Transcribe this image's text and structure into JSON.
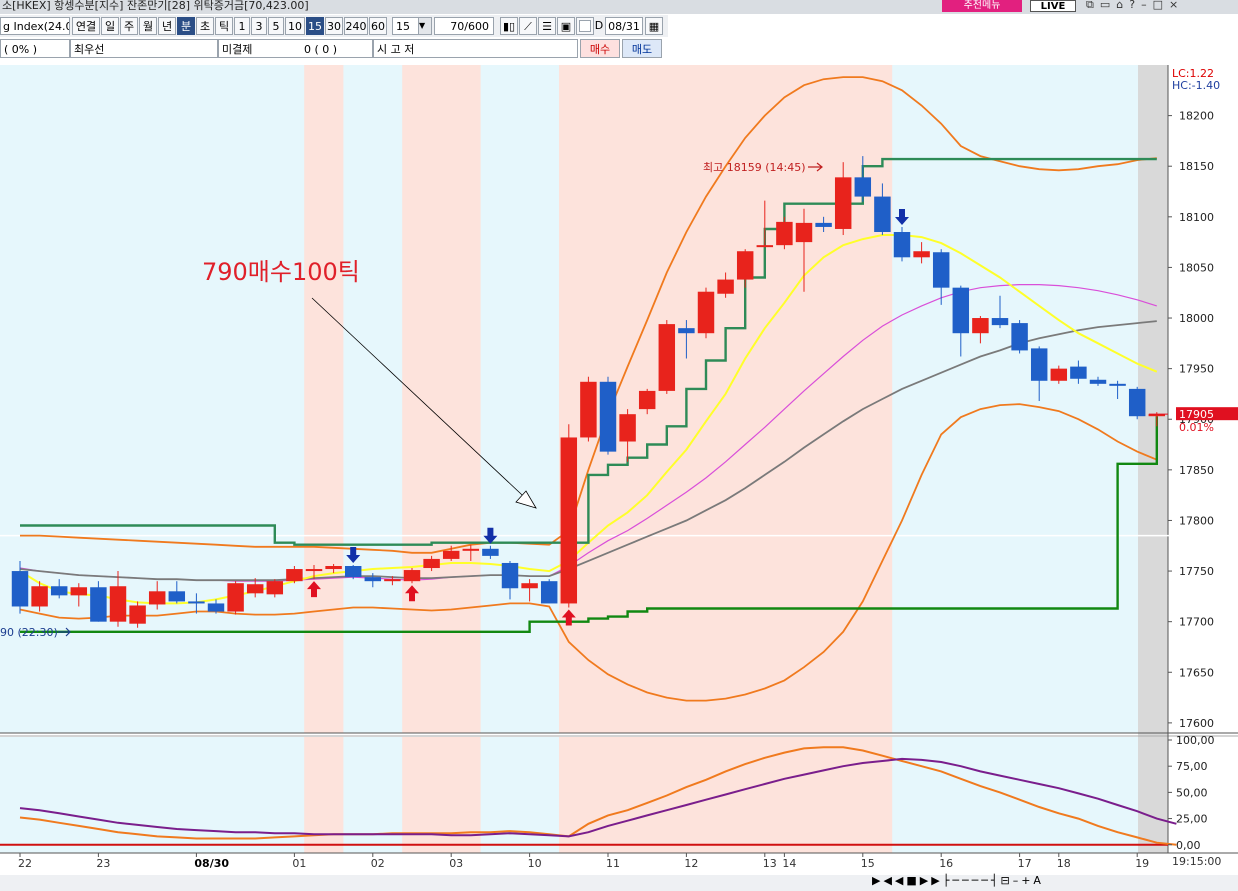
{
  "window": {
    "title": "소[HKEX] 항셍수분[지수] 잔존만기[28] 위탁증거금[70,423.00]",
    "promo_label": "추천메뉴",
    "live_label": "LIVE"
  },
  "toolbar": {
    "symbol": "g Index(24.0",
    "buttons": [
      "연결",
      "일",
      "주",
      "월",
      "년",
      "분",
      "초",
      "틱",
      "1",
      "3",
      "5",
      "10",
      "15",
      "30",
      "240",
      "60"
    ],
    "selected": [
      "분",
      "15"
    ],
    "interval_value": "15",
    "count_value": "70/600",
    "d_label": "D",
    "date_value": "08/31"
  },
  "inforow": {
    "change": "(      0%  )",
    "best_label": "최우선",
    "unsettled_label": "미결제",
    "unsettled_value": "0 (       0     )",
    "ohl_label": "시          고          저",
    "buy_label": "매수",
    "sell_label": "매도"
  },
  "colors": {
    "up": "#e8231c",
    "down": "#1f5fc8",
    "shade_pink": "#fde3dc",
    "bg_cyan": "#e6f7fc",
    "band": "#f07a1e",
    "ma_yellow": "#ffff2a",
    "ma_magenta": "#d94fd9",
    "ma_gray": "#7a7a7a",
    "trail_upper": "#2e8b57",
    "trail_lower": "#118811",
    "stoch1": "#7a1e8c",
    "stoch2": "#f07a1e"
  },
  "chart_data": {
    "type": "candlestick",
    "legend": [
      "LC:1.22",
      "HC:-1.40"
    ],
    "y_ticks": [
      18200,
      18150,
      18100,
      18050,
      18000,
      17950,
      17900,
      17850,
      17800,
      17750,
      17700,
      17650,
      17600
    ],
    "ylim": [
      17590,
      18250
    ],
    "price_label": "17905",
    "price_change": "0.01%",
    "high_annotation": "최고 18159 (14:45)",
    "low_annotation": "90 (22:30)",
    "annotation": "790매수100틱",
    "x_labels": [
      "22",
      "23",
      "08/30",
      "01",
      "02",
      "03",
      "10",
      "11",
      "12",
      "13",
      "14",
      "15",
      "16",
      "17",
      "18",
      "19"
    ],
    "time_label": "19:15:00",
    "white_line": 17785,
    "candles": [
      {
        "o": 17750,
        "h": 17760,
        "l": 17708,
        "c": 17715
      },
      {
        "o": 17715,
        "h": 17740,
        "l": 17710,
        "c": 17735
      },
      {
        "o": 17735,
        "h": 17742,
        "l": 17723,
        "c": 17726
      },
      {
        "o": 17726,
        "h": 17738,
        "l": 17715,
        "c": 17734
      },
      {
        "o": 17734,
        "h": 17740,
        "l": 17700,
        "c": 17700
      },
      {
        "o": 17700,
        "h": 17750,
        "l": 17695,
        "c": 17735
      },
      {
        "o": 17698,
        "h": 17720,
        "l": 17694,
        "c": 17716
      },
      {
        "o": 17717,
        "h": 17740,
        "l": 17712,
        "c": 17730
      },
      {
        "o": 17730,
        "h": 17740,
        "l": 17718,
        "c": 17720
      },
      {
        "o": 17720,
        "h": 17728,
        "l": 17708,
        "c": 17718
      },
      {
        "o": 17718,
        "h": 17722,
        "l": 17708,
        "c": 17710
      },
      {
        "o": 17710,
        "h": 17740,
        "l": 17707,
        "c": 17738
      },
      {
        "o": 17728,
        "h": 17743,
        "l": 17724,
        "c": 17737
      },
      {
        "o": 17727,
        "h": 17742,
        "l": 17724,
        "c": 17740
      },
      {
        "o": 17740,
        "h": 17755,
        "l": 17738,
        "c": 17752
      },
      {
        "o": 17750,
        "h": 17756,
        "l": 17742,
        "c": 17752
      },
      {
        "o": 17752,
        "h": 17757,
        "l": 17748,
        "c": 17755
      },
      {
        "o": 17755,
        "h": 17756,
        "l": 17742,
        "c": 17744
      },
      {
        "o": 17744,
        "h": 17748,
        "l": 17734,
        "c": 17740
      },
      {
        "o": 17740,
        "h": 17745,
        "l": 17736,
        "c": 17742
      },
      {
        "o": 17740,
        "h": 17753,
        "l": 17738,
        "c": 17751
      },
      {
        "o": 17753,
        "h": 17765,
        "l": 17750,
        "c": 17762
      },
      {
        "o": 17762,
        "h": 17775,
        "l": 17760,
        "c": 17770
      },
      {
        "o": 17770,
        "h": 17776,
        "l": 17760,
        "c": 17772
      },
      {
        "o": 17772,
        "h": 17775,
        "l": 17762,
        "c": 17765
      },
      {
        "o": 17758,
        "h": 17760,
        "l": 17722,
        "c": 17733
      },
      {
        "o": 17733,
        "h": 17742,
        "l": 17720,
        "c": 17738
      },
      {
        "o": 17740,
        "h": 17742,
        "l": 17718,
        "c": 17718
      },
      {
        "o": 17718,
        "h": 17895,
        "l": 17714,
        "c": 17882
      },
      {
        "o": 17882,
        "h": 17942,
        "l": 17878,
        "c": 17937
      },
      {
        "o": 17937,
        "h": 17942,
        "l": 17865,
        "c": 17868
      },
      {
        "o": 17878,
        "h": 17910,
        "l": 17858,
        "c": 17905
      },
      {
        "o": 17910,
        "h": 17930,
        "l": 17905,
        "c": 17928
      },
      {
        "o": 17928,
        "h": 17998,
        "l": 17925,
        "c": 17994
      },
      {
        "o": 17990,
        "h": 17998,
        "l": 17960,
        "c": 17985
      },
      {
        "o": 17985,
        "h": 18030,
        "l": 17980,
        "c": 18026
      },
      {
        "o": 18024,
        "h": 18045,
        "l": 18020,
        "c": 18038
      },
      {
        "o": 18038,
        "h": 18068,
        "l": 18030,
        "c": 18066
      },
      {
        "o": 18072,
        "h": 18116,
        "l": 18070,
        "c": 18072
      },
      {
        "o": 18072,
        "h": 18100,
        "l": 18068,
        "c": 18095
      },
      {
        "o": 18075,
        "h": 18108,
        "l": 18026,
        "c": 18094
      },
      {
        "o": 18094,
        "h": 18100,
        "l": 18085,
        "c": 18090
      },
      {
        "o": 18088,
        "h": 18154,
        "l": 18082,
        "c": 18139
      },
      {
        "o": 18139,
        "h": 18160,
        "l": 18115,
        "c": 18120
      },
      {
        "o": 18120,
        "h": 18133,
        "l": 18082,
        "c": 18085
      },
      {
        "o": 18085,
        "h": 18090,
        "l": 18056,
        "c": 18060
      },
      {
        "o": 18060,
        "h": 18075,
        "l": 18054,
        "c": 18066
      },
      {
        "o": 18065,
        "h": 18068,
        "l": 18013,
        "c": 18030
      },
      {
        "o": 18030,
        "h": 18032,
        "l": 17962,
        "c": 17985
      },
      {
        "o": 17985,
        "h": 18002,
        "l": 17975,
        "c": 18000
      },
      {
        "o": 18000,
        "h": 18022,
        "l": 17990,
        "c": 17993
      },
      {
        "o": 17995,
        "h": 17998,
        "l": 17965,
        "c": 17968
      },
      {
        "o": 17970,
        "h": 17972,
        "l": 17918,
        "c": 17938
      },
      {
        "o": 17938,
        "h": 17953,
        "l": 17935,
        "c": 17950
      },
      {
        "o": 17952,
        "h": 17958,
        "l": 17935,
        "c": 17940
      },
      {
        "o": 17939,
        "h": 17942,
        "l": 17933,
        "c": 17935
      },
      {
        "o": 17935,
        "h": 17938,
        "l": 17920,
        "c": 17934
      },
      {
        "o": 17930,
        "h": 17932,
        "l": 17900,
        "c": 17903
      },
      {
        "o": 17903,
        "h": 17907,
        "l": 17893,
        "c": 17905
      }
    ],
    "markers": [
      {
        "i": 17,
        "type": "sell"
      },
      {
        "i": 15,
        "type": "buy"
      },
      {
        "i": 20,
        "type": "buy"
      },
      {
        "i": 24,
        "type": "sell"
      },
      {
        "i": 28,
        "type": "buy"
      },
      {
        "i": 45,
        "type": "sell"
      }
    ],
    "ma_yellow": [
      17750,
      17738,
      17730,
      17727,
      17726,
      17722,
      17719,
      17718,
      17718,
      17719,
      17722,
      17726,
      17730,
      17735,
      17740,
      17745,
      17748,
      17750,
      17752,
      17753,
      17754,
      17756,
      17758,
      17758,
      17757,
      17755,
      17752,
      17750,
      17760,
      17778,
      17795,
      17808,
      17825,
      17848,
      17870,
      17898,
      17925,
      17960,
      17990,
      18015,
      18042,
      18060,
      18072,
      18078,
      18082,
      18082,
      18080,
      18074,
      18064,
      18052,
      18040,
      18026,
      18012,
      17998,
      17985,
      17975,
      17965,
      17955,
      17947
    ],
    "ma_magenta": [
      17753,
      17750,
      17748,
      17746,
      17745,
      17744,
      17743,
      17742,
      17742,
      17741,
      17741,
      17740,
      17740,
      17740,
      17741,
      17742,
      17743,
      17744,
      17743,
      17742,
      17741,
      17742,
      17744,
      17745,
      17746,
      17746,
      17745,
      17745,
      17755,
      17768,
      17780,
      17790,
      17802,
      17815,
      17828,
      17842,
      17858,
      17875,
      17892,
      17910,
      17928,
      17945,
      17962,
      17978,
      17992,
      18003,
      18012,
      18020,
      18026,
      18030,
      18032,
      18033,
      18033,
      18032,
      18030,
      18027,
      18023,
      18018,
      18012
    ],
    "ma_gray": [
      17752,
      17750,
      17748,
      17746,
      17745,
      17744,
      17743,
      17742,
      17742,
      17741,
      17741,
      17741,
      17741,
      17741,
      17742,
      17743,
      17744,
      17745,
      17745,
      17744,
      17743,
      17743,
      17744,
      17745,
      17746,
      17746,
      17745,
      17745,
      17752,
      17760,
      17768,
      17776,
      17784,
      17792,
      17800,
      17810,
      17820,
      17832,
      17845,
      17858,
      17872,
      17885,
      17898,
      17910,
      17920,
      17930,
      17938,
      17946,
      17954,
      17962,
      17968,
      17975,
      17980,
      17984,
      17988,
      17991,
      17993,
      17995,
      17997
    ],
    "band_upper": [
      17785,
      17785,
      17784,
      17783,
      17782,
      17781,
      17780,
      17779,
      17778,
      17777,
      17776,
      17775,
      17774,
      17774,
      17774,
      17774,
      17773,
      17772,
      17771,
      17770,
      17768,
      17768,
      17772,
      17776,
      17778,
      17778,
      17777,
      17776,
      17790,
      17850,
      17905,
      17952,
      17998,
      18045,
      18085,
      18120,
      18150,
      18178,
      18200,
      18218,
      18230,
      18236,
      18238,
      18238,
      18234,
      18225,
      18210,
      18192,
      18170,
      18160,
      18155,
      18150,
      18147,
      18146,
      18147,
      18150,
      18152,
      18156,
      18158
    ],
    "band_lower": [
      17712,
      17708,
      17704,
      17703,
      17704,
      17706,
      17706,
      17706,
      17708,
      17710,
      17710,
      17708,
      17707,
      17707,
      17708,
      17710,
      17712,
      17714,
      17714,
      17713,
      17712,
      17711,
      17712,
      17714,
      17716,
      17718,
      17718,
      17715,
      17680,
      17662,
      17648,
      17638,
      17630,
      17625,
      17622,
      17622,
      17624,
      17628,
      17634,
      17642,
      17655,
      17670,
      17690,
      17720,
      17760,
      17800,
      17845,
      17885,
      17902,
      17910,
      17914,
      17915,
      17912,
      17908,
      17900,
      17890,
      17878,
      17868,
      17860
    ],
    "trail_upper": [
      17795,
      17795,
      17795,
      17795,
      17795,
      17795,
      17795,
      17795,
      17795,
      17795,
      17795,
      17795,
      17795,
      17778,
      17776,
      17776,
      17776,
      17776,
      17776,
      17776,
      17776,
      17778,
      17778,
      17778,
      17778,
      17778,
      17778,
      17778,
      17778,
      17845,
      17855,
      17862,
      17875,
      17893,
      17930,
      17958,
      17990,
      18040,
      18088,
      18113,
      18113,
      18113,
      18113,
      18150,
      18157,
      18157,
      18157,
      18157,
      18157,
      18157,
      18157,
      18157,
      18157,
      18157,
      18157,
      18157,
      18157,
      18157,
      18157
    ],
    "trail_lower": [
      17690,
      17690,
      17690,
      17690,
      17690,
      17690,
      17690,
      17690,
      17690,
      17690,
      17690,
      17690,
      17690,
      17690,
      17690,
      17690,
      17690,
      17690,
      17690,
      17690,
      17690,
      17690,
      17690,
      17690,
      17690,
      17690,
      17700,
      17700,
      17700,
      17703,
      17705,
      17710,
      17713,
      17713,
      17713,
      17713,
      17713,
      17713,
      17713,
      17713,
      17713,
      17713,
      17713,
      17713,
      17713,
      17713,
      17713,
      17713,
      17713,
      17713,
      17713,
      17713,
      17713,
      17713,
      17713,
      17713,
      17856,
      17856,
      17903,
      17915,
      17915,
      17915,
      17915,
      17915,
      17915
    ],
    "shaded_ranges": [
      [
        15,
        16
      ],
      [
        20,
        23
      ],
      [
        28,
        44
      ]
    ],
    "stoch_ylim": [
      -5,
      100
    ],
    "stoch_ticks": [
      100,
      75,
      50,
      25,
      0
    ],
    "stoch_ticks_labels": [
      "100,00",
      "75,00",
      "50,00",
      "25,00",
      "0,00"
    ],
    "stoch_a": [
      35,
      33,
      30,
      27,
      24,
      21,
      19,
      17,
      15,
      14,
      13,
      12,
      12,
      11,
      11,
      10,
      10,
      10,
      10,
      10,
      10,
      10,
      9,
      9,
      10,
      11,
      10,
      9,
      8,
      12,
      18,
      23,
      28,
      33,
      38,
      43,
      48,
      53,
      58,
      63,
      67,
      71,
      75,
      78,
      80,
      82,
      81,
      79,
      75,
      70,
      66,
      62,
      58,
      54,
      49,
      44,
      38,
      32,
      25,
      20
    ],
    "stoch_b": [
      26,
      24,
      21,
      18,
      15,
      12,
      10,
      8,
      7,
      6,
      6,
      6,
      6,
      7,
      8,
      9,
      10,
      10,
      10,
      11,
      11,
      11,
      11,
      12,
      12,
      13,
      12,
      10,
      8,
      20,
      28,
      33,
      40,
      47,
      55,
      62,
      70,
      77,
      83,
      88,
      92,
      93,
      93,
      90,
      85,
      80,
      75,
      70,
      63,
      56,
      50,
      43,
      36,
      30,
      25,
      18,
      12,
      7,
      2,
      0
    ],
    "stoch_red": 0
  }
}
